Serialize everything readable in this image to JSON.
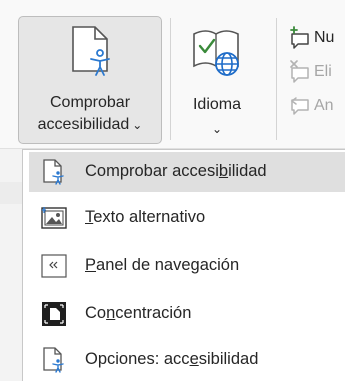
{
  "ribbon": {
    "accessibility_button": {
      "label_line1": "Comprobar",
      "label_line2": "accesibilidad",
      "chevron": "⌄",
      "icon": "accessibility-check-icon"
    },
    "language_button": {
      "label": "Idioma",
      "chevron": "⌄",
      "icon": "language-globe-icon"
    },
    "comments": [
      {
        "label": "Nu",
        "icon": "new-comment-icon",
        "enabled": true
      },
      {
        "label": "Eli",
        "icon": "delete-comment-icon",
        "enabled": false
      },
      {
        "label": "An",
        "icon": "previous-comment-icon",
        "enabled": false
      }
    ]
  },
  "menu": {
    "items": [
      {
        "pre": "Comprobar accesi",
        "key": "b",
        "post": "ilidad",
        "icon": "accessibility-check-icon"
      },
      {
        "pre": "",
        "key": "T",
        "post": "exto alternativo",
        "icon": "alt-text-icon"
      },
      {
        "pre": "",
        "key": "P",
        "post": "anel de navegación",
        "icon": "navigation-pane-icon"
      },
      {
        "pre": "Co",
        "key": "n",
        "post": "centración",
        "icon": "focus-icon"
      },
      {
        "pre": "Opciones: acc",
        "key": "e",
        "post": "sibilidad",
        "icon": "accessibility-options-icon"
      }
    ]
  },
  "colors": {
    "accent_blue": "#2b79d0",
    "globe_blue": "#1e6cc8",
    "check_green": "#3a8a3a",
    "hover_gray": "#dfdfdf",
    "disabled_text": "#a6a6a6"
  }
}
